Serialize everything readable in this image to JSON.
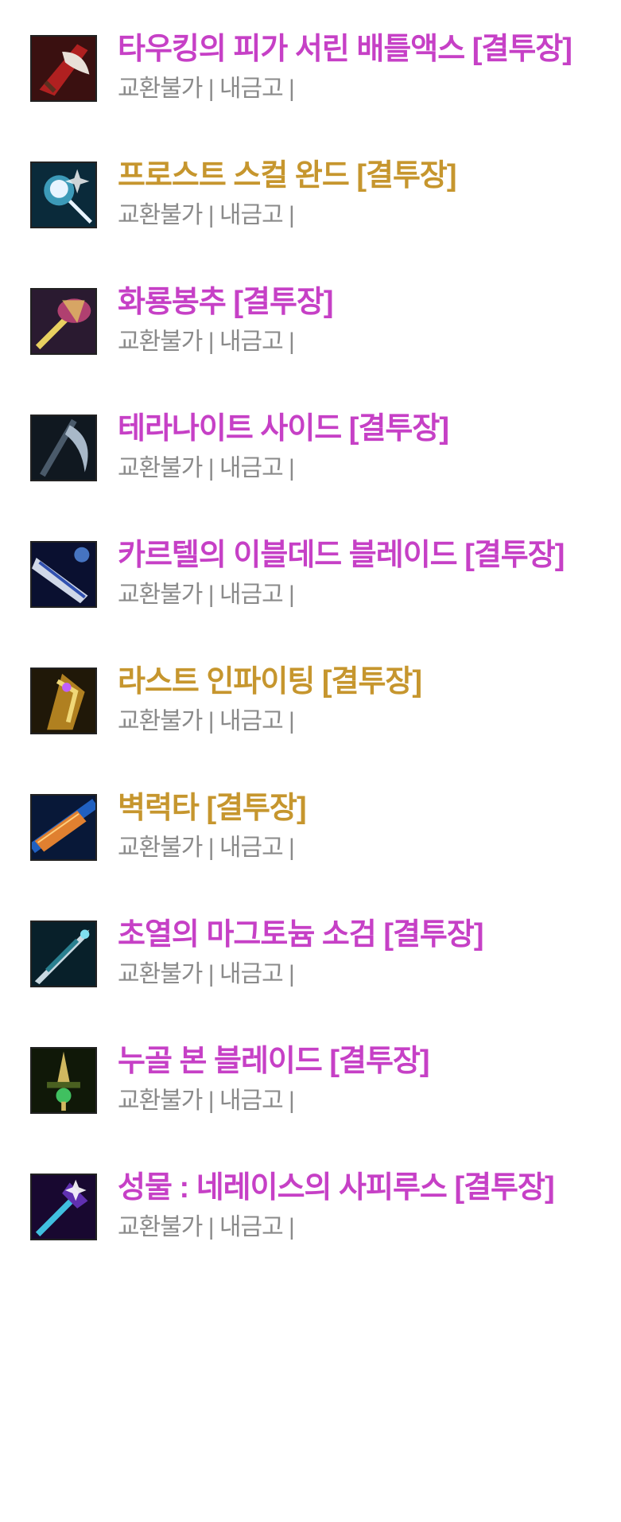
{
  "items": [
    {
      "name": "타우킹의 피가 서린 배틀액스 [결투장]",
      "meta": "교환불가 | 내금고 |",
      "grade": "epic",
      "icon": "battle-axe-icon",
      "colors": [
        "#3a1010",
        "#b02020",
        "#e8e0d8"
      ]
    },
    {
      "name": "프로스트 스컬 완드 [결투장]",
      "meta": "교환불가 | 내금고 |",
      "grade": "legend",
      "icon": "frost-skull-wand-icon",
      "colors": [
        "#0a2a3a",
        "#3c9ab8",
        "#e8f4ff"
      ]
    },
    {
      "name": "화룡봉추 [결투장]",
      "meta": "교환불가 | 내금고 |",
      "grade": "epic",
      "icon": "fire-dragon-mace-icon",
      "colors": [
        "#2a1a30",
        "#b04070",
        "#e8d060"
      ]
    },
    {
      "name": "테라나이트 사이드 [결투장]",
      "meta": "교환불가 | 내금고 |",
      "grade": "epic",
      "icon": "teranite-scythe-icon",
      "colors": [
        "#101820",
        "#4a5a6a",
        "#a8b8c8"
      ]
    },
    {
      "name": "카르텔의 이블데드 블레이드 [결투장]",
      "meta": "교환불가 | 내금고 |",
      "grade": "epic",
      "icon": "evil-dead-blade-icon",
      "colors": [
        "#0a1030",
        "#3050b0",
        "#d0d8e8"
      ]
    },
    {
      "name": "라스트 인파이팅 [결투장]",
      "meta": "교환불가 | 내금고 |",
      "grade": "legend",
      "icon": "last-infighting-icon",
      "colors": [
        "#201808",
        "#b08020",
        "#f0d878"
      ]
    },
    {
      "name": "벽력타 [결투장]",
      "meta": "교환불가 | 내금고 |",
      "grade": "legend",
      "icon": "thunder-strike-icon",
      "colors": [
        "#081838",
        "#2060c0",
        "#e08030"
      ]
    },
    {
      "name": "초열의 마그토늄 소검 [결투장]",
      "meta": "교환불가 | 내금고 |",
      "grade": "epic",
      "icon": "magtonium-short-sword-icon",
      "colors": [
        "#08202a",
        "#2a8090",
        "#c8d8e0"
      ]
    },
    {
      "name": "누골 본 블레이드 [결투장]",
      "meta": "교환불가 | 내금고 |",
      "grade": "epic",
      "icon": "nugol-bone-blade-icon",
      "colors": [
        "#101808",
        "#4a6020",
        "#d0b860"
      ]
    },
    {
      "name": "성물 : 네레이스의 사피루스 [결투장]",
      "meta": "교환불가 | 내금고 |",
      "grade": "epic",
      "icon": "nereis-sapphirus-icon",
      "colors": [
        "#180830",
        "#6030b0",
        "#40c0e0"
      ]
    }
  ]
}
